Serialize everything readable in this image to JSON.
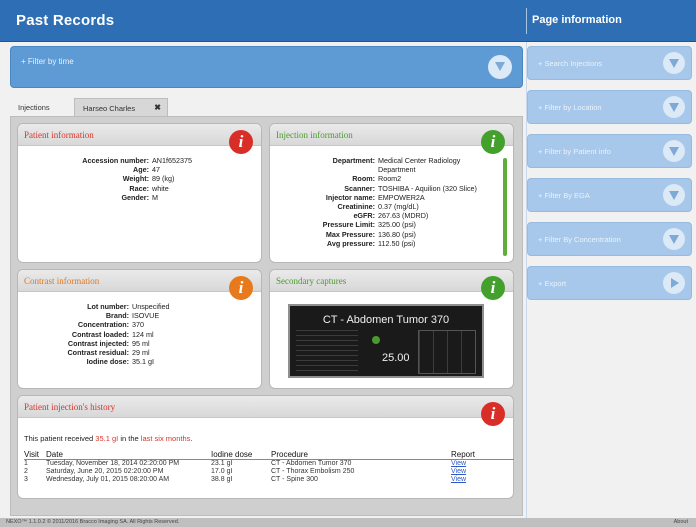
{
  "header": {
    "title": "Past Records",
    "page_info_title": "Page information"
  },
  "filter_by_time": "Filter by time",
  "tabs": [
    {
      "label": "Injections"
    },
    {
      "label": "Harseo Charles",
      "close": "✖"
    }
  ],
  "patient_info": {
    "title": "Patient information",
    "icon": "i",
    "rows": [
      {
        "k": "Accession number:",
        "v": "AN1f652375"
      },
      {
        "k": "Age:",
        "v": "47"
      },
      {
        "k": "Weight:",
        "v": "89 (kg)"
      },
      {
        "k": "Race:",
        "v": "white"
      },
      {
        "k": "Gender:",
        "v": "M"
      }
    ]
  },
  "injection_info": {
    "title": "Injection information",
    "icon": "i",
    "rows": [
      {
        "k": "Department:",
        "v": "Medical Center Radiology Department"
      },
      {
        "k": "Room:",
        "v": "Room2"
      },
      {
        "k": "Scanner:",
        "v": "TOSHIBA - Aquilion (320 Slice)"
      },
      {
        "k": "Injector name:",
        "v": "EMPOWER2A"
      },
      {
        "k": "Creatinine:",
        "v": "0.37 (mg/dL)"
      },
      {
        "k": "eGFR:",
        "v": "267.63 (MDRD)"
      },
      {
        "k": "Pressure Limit:",
        "v": "325.00 (psi)"
      },
      {
        "k": "Max Pressure:",
        "v": "136.80 (psi)"
      },
      {
        "k": "Avg pressure:",
        "v": "112.50 (psi)"
      }
    ]
  },
  "contrast_info": {
    "title": "Contrast information",
    "icon": "i",
    "rows": [
      {
        "k": "Lot number:",
        "v": "Unspecified"
      },
      {
        "k": "Brand:",
        "v": "ISOVUE"
      },
      {
        "k": "Concentration:",
        "v": "370"
      },
      {
        "k": "Contrast loaded:",
        "v": "124 ml"
      },
      {
        "k": "Contrast injected:",
        "v": "95 ml"
      },
      {
        "k": "Contrast residual:",
        "v": "29 ml"
      },
      {
        "k": "Iodine dose:",
        "v": "35.1 gI"
      }
    ]
  },
  "secondary_captures": {
    "title": "Secondary captures",
    "icon": "i",
    "capture_title": "CT - Abdomen Tumor 370",
    "capture_value": "25.00"
  },
  "history": {
    "title": "Patient injection's history",
    "icon": "i",
    "text_prefix": "This patient received",
    "text_amount": "35.1 gI",
    "text_middle": "in the",
    "text_period": "last six months",
    "text_end": ".",
    "columns": [
      "Visit",
      "Date",
      "Iodine dose",
      "Procedure",
      "Report"
    ],
    "rows": [
      {
        "visit": "1",
        "date": "Tuesday, November 18, 2014 02:20:00 PM",
        "dose": "23.1 gI",
        "procedure": "CT - Abdomen Tumor 370",
        "report": "View"
      },
      {
        "visit": "2",
        "date": "Saturday, June 20, 2015 02:20:00 PM",
        "dose": "17.0 gI",
        "procedure": "CT - Thorax Embolism 250",
        "report": "View"
      },
      {
        "visit": "3",
        "date": "Wednesday, July 01, 2015 08:20:00 AM",
        "dose": "38.8 gI",
        "procedure": "CT - Spine 300",
        "report": "View"
      }
    ]
  },
  "sidebar": {
    "filters": [
      {
        "label": "Search Injections"
      },
      {
        "label": "Filter by Location"
      },
      {
        "label": "Filter by Patient info"
      },
      {
        "label": "Filter By EGA"
      },
      {
        "label": "Filter By Concentration"
      },
      {
        "label": "Export"
      }
    ]
  },
  "footer": {
    "copyright": "NEXO™ 1.1.0.2 © 2011/2016 Bracco Imaging SA. All Rights Reserved.",
    "about": "About"
  },
  "colors": {
    "header_blue": "#2d6eb5",
    "red": "#d9342b",
    "green": "#43a02c",
    "orange": "#e77a1d"
  }
}
